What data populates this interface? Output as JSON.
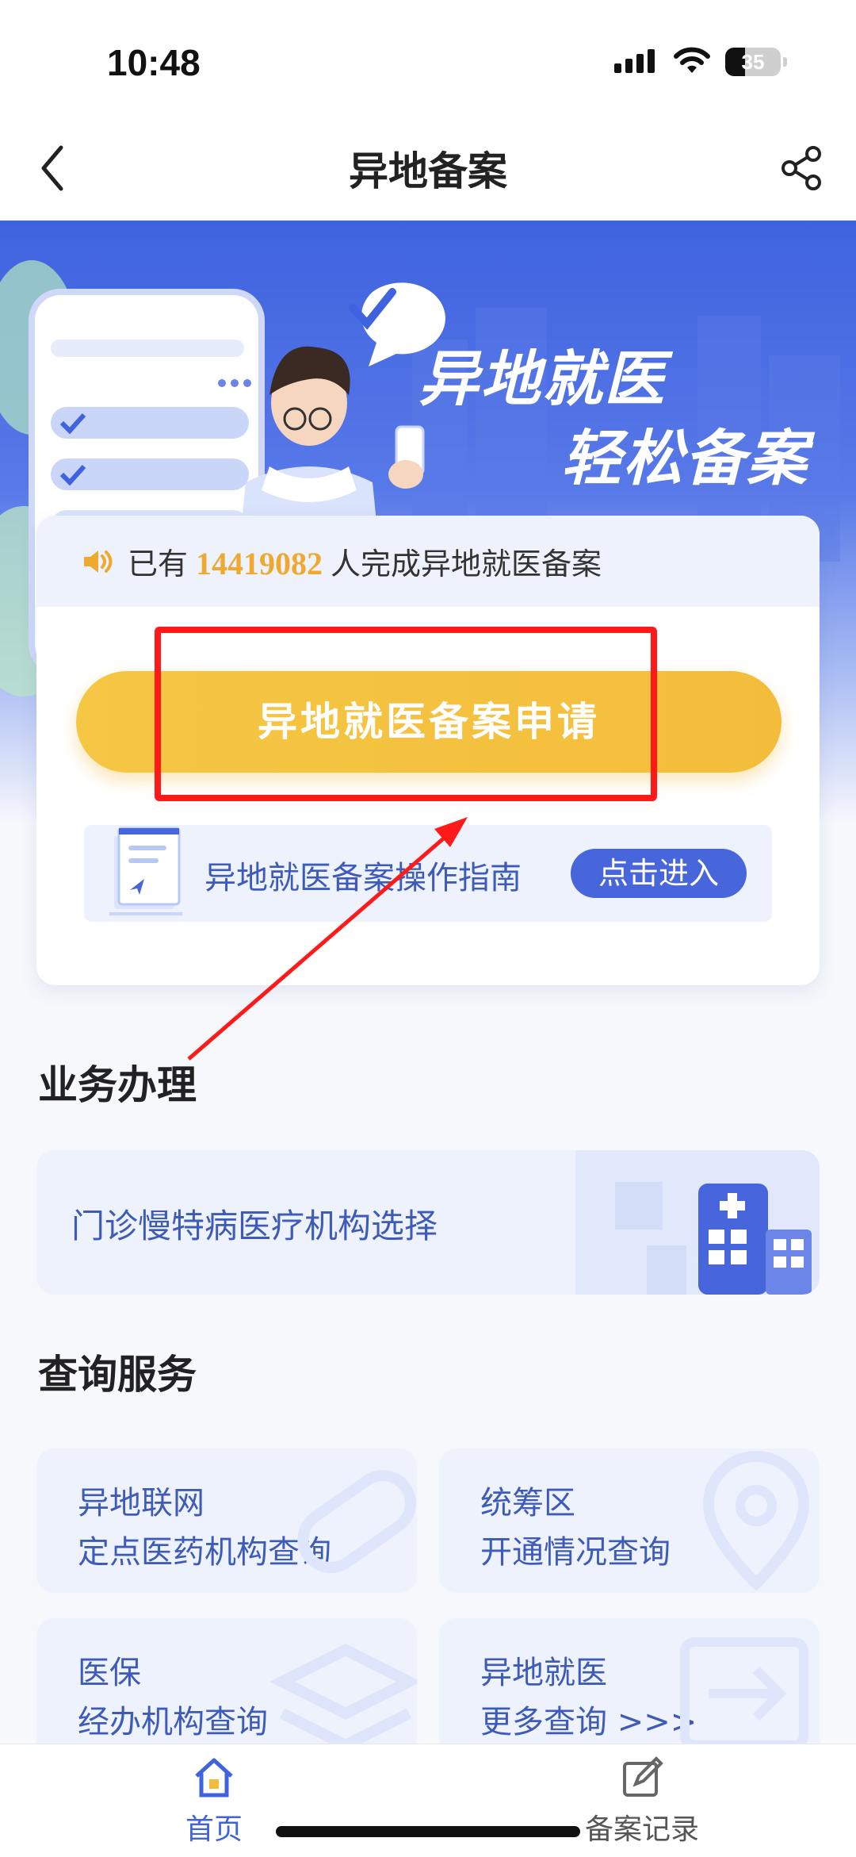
{
  "status": {
    "time": "10:48",
    "battery": "35"
  },
  "nav": {
    "title": "异地备案"
  },
  "banner": {
    "line1": "异地就医",
    "line2": "轻松备案"
  },
  "notice": {
    "prefix": "已有",
    "count": "14419082",
    "suffix": "人完成异地就医备案"
  },
  "apply_button": "异地就医备案申请",
  "guide": {
    "text": "异地就医备案操作指南",
    "button": "点击进入"
  },
  "business": {
    "title": "业务办理",
    "item": "门诊慢特病医疗机构选择"
  },
  "query": {
    "title": "查询服务",
    "cards": [
      {
        "line1": "异地联网",
        "line2": "定点医药机构查询"
      },
      {
        "line1": "统筹区",
        "line2": "开通情况查询"
      },
      {
        "line1": "医保",
        "line2": "经办机构查询"
      },
      {
        "line1": "异地就医",
        "line2": "更多查询 >>>"
      }
    ]
  },
  "tabs": [
    {
      "label": "首页",
      "icon": "home-icon",
      "active": true,
      "color": "#3f63df"
    },
    {
      "label": "备案记录",
      "icon": "edit-record-icon",
      "active": false,
      "color": "#555555"
    }
  ],
  "colors": {
    "primary": "#3f63df",
    "apply": "#f3bd3b",
    "highlight": "#f0a930",
    "annotation": "#ff1a1a"
  }
}
